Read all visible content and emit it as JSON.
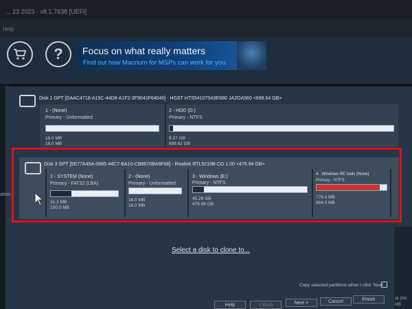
{
  "window": {
    "title": "... 23 2023 - v8.1.7638 [UEFI]"
  },
  "menu": {
    "help": "Help"
  },
  "toolbar": {
    "cart_icon": "shopping-cart-icon",
    "help_icon": "question-mark-icon"
  },
  "banner": {
    "headline": "Focus on what really matters",
    "subline": "Find out how Macrium for MSPs can work for you"
  },
  "disk1": {
    "title": "Disk 1 GPT [DAAC4718-A15C-44D8-A1F2-3F9041F64040] - HGST HTS541075A9E680 JA2OA560  <698.64 GB>",
    "partitions": [
      {
        "name": "1 - (None)",
        "type": "Primary - Unformatted",
        "used": "16.0 MB",
        "total": "16.0 MB",
        "fill": 0.0
      },
      {
        "name": "2 - HDD (D:)",
        "type": "Primary - NTFS",
        "used": "9.37 GB",
        "total": "698.62 GB",
        "fill": 0.015
      }
    ]
  },
  "disk3": {
    "title": "Disk 3 GPT [5E77A45A-0985-44C7-BA10-CB8670BA9F68] - Realtek  RTL9210B-CG      1.00  <476.94 GB>",
    "partitions": [
      {
        "name": "1 - SYSTEM (None)",
        "type": "Primary - FAT32 (LBA)",
        "used": "31.3 MB",
        "total": "100.0 MB",
        "fill": 0.31
      },
      {
        "name": "2 -  (None)",
        "type": "Primary - Unformatted",
        "used": "16.0 MB",
        "total": "16.0 MB",
        "fill": 0.0
      },
      {
        "name": "3 - Windows (E:)",
        "type": "Primary - NTFS",
        "used": "45.28 GB",
        "total": "475.98 GB",
        "fill": 0.095
      },
      {
        "name": "4 - Windows RE tools (None)",
        "type": "Primary - NTFS",
        "used": "779.4 MB",
        "total": "864.0 MB",
        "fill": 0.9
      }
    ]
  },
  "left_label": "ation",
  "clone_prompt": "Select a disk to clone to...",
  "copy_option": "Copy selected partitions when I click 'Next'",
  "buttons": {
    "help": "Help",
    "back": "< Back",
    "next": "Next >",
    "cancel": "Cancel",
    "finish": "Finish"
  },
  "right_strip": {
    "line1": "sk (No",
    "line2": "MB"
  },
  "colors": {
    "accent_red": "#e0101b",
    "banner_link": "#54b3ff",
    "panel_bg": "#273646",
    "partition4_fill": "#c9342d"
  }
}
